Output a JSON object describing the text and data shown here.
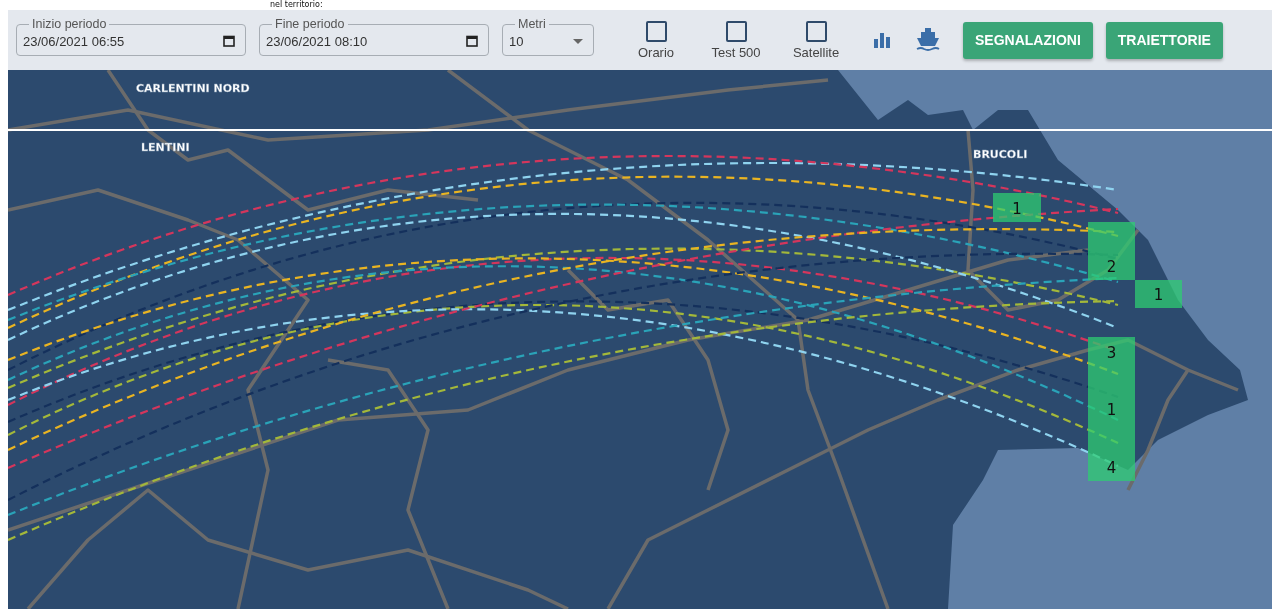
{
  "top_text": "nel territorio:",
  "toolbar": {
    "fields": [
      {
        "kind": "datetime",
        "label": "Inizio periodo",
        "value": "23/06/2021 06:55"
      },
      {
        "kind": "datetime",
        "label": "Fine periodo",
        "value": "23/06/2021 08:10"
      },
      {
        "kind": "select",
        "label": "Metri",
        "value": "10"
      }
    ],
    "checkboxes": [
      {
        "label": "Orario",
        "checked": false
      },
      {
        "label": "Test 500",
        "checked": false
      },
      {
        "label": "Satellite",
        "checked": false
      }
    ],
    "buttons": [
      "SEGNALAZIONI",
      "TRAIETTORIE"
    ]
  },
  "map": {
    "places": [
      "CARLENTINI NORD",
      "LENTINI",
      "BRUCOLI"
    ],
    "cells": [
      {
        "count": "1"
      },
      {
        "count": "2"
      },
      {
        "count": "1"
      },
      {
        "count": "3"
      },
      {
        "count": "1"
      },
      {
        "count": "4"
      }
    ]
  }
}
